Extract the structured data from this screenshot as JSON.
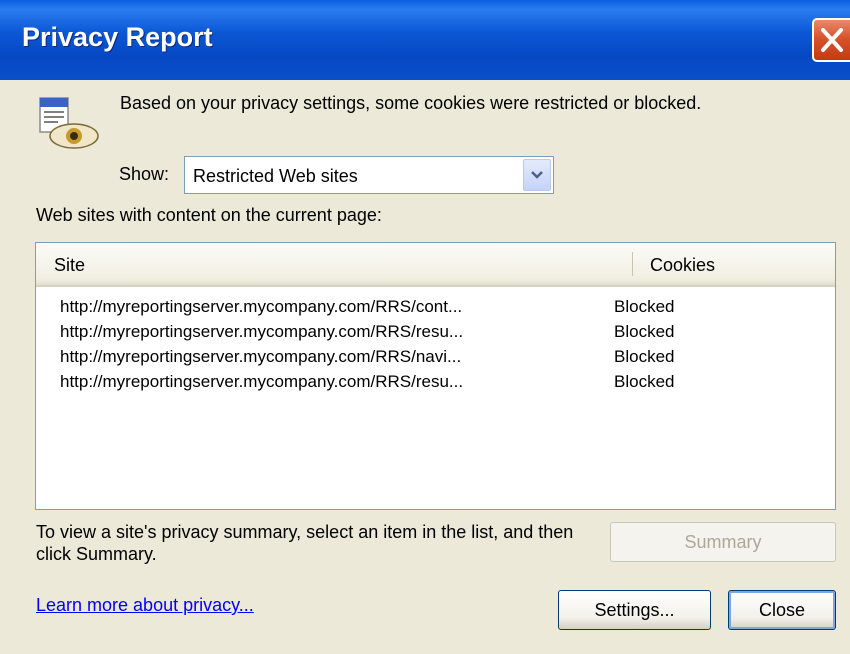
{
  "window": {
    "title": "Privacy Report",
    "close_icon": "close-x-icon",
    "app_icon": "privacy-eye-icon"
  },
  "info": {
    "message": "Based on your privacy settings, some cookies were restricted or blocked."
  },
  "show": {
    "label": "Show:",
    "selected": "Restricted Web sites"
  },
  "list": {
    "caption": "Web sites with content on the current page:",
    "columns": [
      "Site",
      "Cookies"
    ],
    "rows": [
      {
        "site": "http://myreportingserver.mycompany.com/RRS/cont...",
        "cookies": "Blocked"
      },
      {
        "site": "http://myreportingserver.mycompany.com/RRS/resu...",
        "cookies": "Blocked"
      },
      {
        "site": "http://myreportingserver.mycompany.com/RRS/navi...",
        "cookies": "Blocked"
      },
      {
        "site": "http://myreportingserver.mycompany.com/RRS/resu...",
        "cookies": "Blocked"
      }
    ]
  },
  "help": {
    "text": "To view a site's privacy summary, select an item in the list, and then click Summary."
  },
  "buttons": {
    "summary": "Summary",
    "settings": "Settings...",
    "close": "Close"
  },
  "link": {
    "learn_more": "Learn more about privacy..."
  },
  "colors": {
    "title_bar": "#0a55d8",
    "close_button": "#d8532c",
    "dialog_bg": "#ece9d8",
    "link": "#0000ff"
  }
}
